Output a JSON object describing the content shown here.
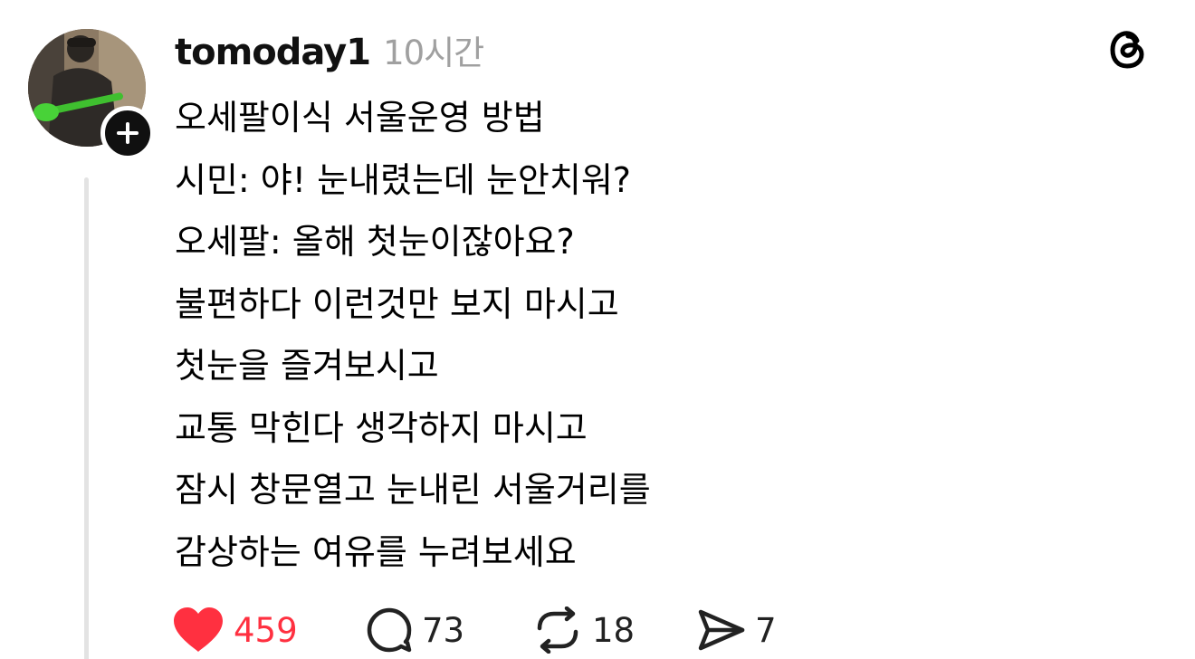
{
  "post": {
    "username": "tomoday1",
    "timestamp": "10시간",
    "body_lines": [
      "오세팔이식 서울운영 방법",
      "시민: 야! 눈내렸는데 눈안치워?",
      "오세팔: 올해 첫눈이잖아요?",
      "불편하다 이런것만 보지 마시고",
      "첫눈을 즐겨보시고",
      "교통 막힌다 생각하지 마시고",
      "잠시 창문열고 눈내린 서울거리를",
      "감상하는 여유를 누려보세요"
    ],
    "stats": {
      "likes": "459",
      "replies": "73",
      "reposts": "18",
      "shares": "7"
    }
  },
  "icons": {
    "avatar": "profile-photo",
    "follow": "plus-icon",
    "logo": "threads-logo-icon",
    "like": "heart-icon",
    "reply": "comment-bubble-icon",
    "repost": "repost-icon",
    "share": "send-icon"
  },
  "colors": {
    "like_active": "#ff3040",
    "timestamp": "#a0a0a0",
    "thread_line": "#e3e3e3"
  }
}
